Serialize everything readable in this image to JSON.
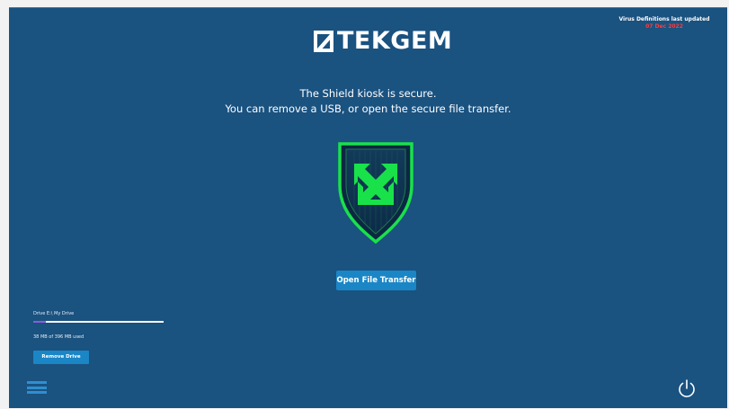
{
  "header": {
    "logo_text": "TEKGEM",
    "virus_definitions_label": "Virus Definitions last updated",
    "virus_definitions_date": "07 Dec 2022"
  },
  "main": {
    "message_line1": "The Shield kiosk is secure.",
    "message_line2": "You can remove a USB, or open the secure file transfer.",
    "open_transfer_label": "Open File Transfer"
  },
  "drive": {
    "name": "Drive E:\\ My Drive",
    "usage_text": "38 MB of 396 MB used",
    "usage_fraction": 0.096,
    "remove_label": "Remove Drive"
  },
  "icons": {
    "menu": "hamburger-menu-icon",
    "power": "power-icon",
    "shield": "shield-icon"
  },
  "colors": {
    "background": "#1a5280",
    "accent": "#1b86c6",
    "shield_green": "#19e14a",
    "alert_red": "#ff3b3b",
    "usage_fill": "#8b5cd6"
  }
}
